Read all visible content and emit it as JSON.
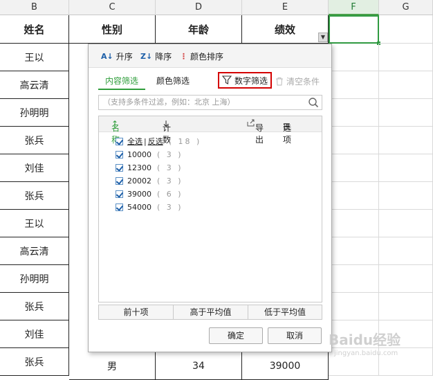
{
  "columns": [
    "B",
    "C",
    "D",
    "E",
    "F",
    "G"
  ],
  "headers": {
    "name": "姓名",
    "gender": "性别",
    "age": "年龄",
    "performance": "绩效"
  },
  "names": [
    "王以",
    "高云清",
    "孙明明",
    "张兵",
    "刘佳",
    "张兵",
    "王以",
    "高云清",
    "孙明明",
    "张兵",
    "刘佳",
    "张兵"
  ],
  "last_row": {
    "gender": "男",
    "age": "34",
    "performance": "39000"
  },
  "popup": {
    "sort": {
      "asc": "升序",
      "desc": "降序",
      "color": "颜色排序"
    },
    "tabs": {
      "content": "内容筛选",
      "color": "颜色筛选"
    },
    "number_filter": "数字筛选",
    "clear_conditions": "清空条件",
    "search_placeholder": "（支持多条件过滤，例如：北京 上海）",
    "list_header": {
      "name": "名称",
      "count": "计数",
      "export": "导出",
      "options": "选项"
    },
    "select_all": "全选",
    "invert": "反选",
    "select_all_count": "( 18 )",
    "items": [
      {
        "label": "10000",
        "count": "( 3 )"
      },
      {
        "label": "12300",
        "count": "( 3 )"
      },
      {
        "label": "20002",
        "count": "( 3 )"
      },
      {
        "label": "39000",
        "count": "( 6 )"
      },
      {
        "label": "54000",
        "count": "( 3 )"
      }
    ],
    "bottom_buttons": {
      "top10": "前十项",
      "above_avg": "高于平均值",
      "below_avg": "低于平均值"
    },
    "ok": "确定",
    "cancel": "取消"
  },
  "watermark": {
    "brand": "Baidu经验",
    "url": "jingyan.baidu.com"
  },
  "colors": {
    "accent_green": "#2e9d3a",
    "highlight_red": "#d40000",
    "icon_blue": "#1d5fa8"
  }
}
